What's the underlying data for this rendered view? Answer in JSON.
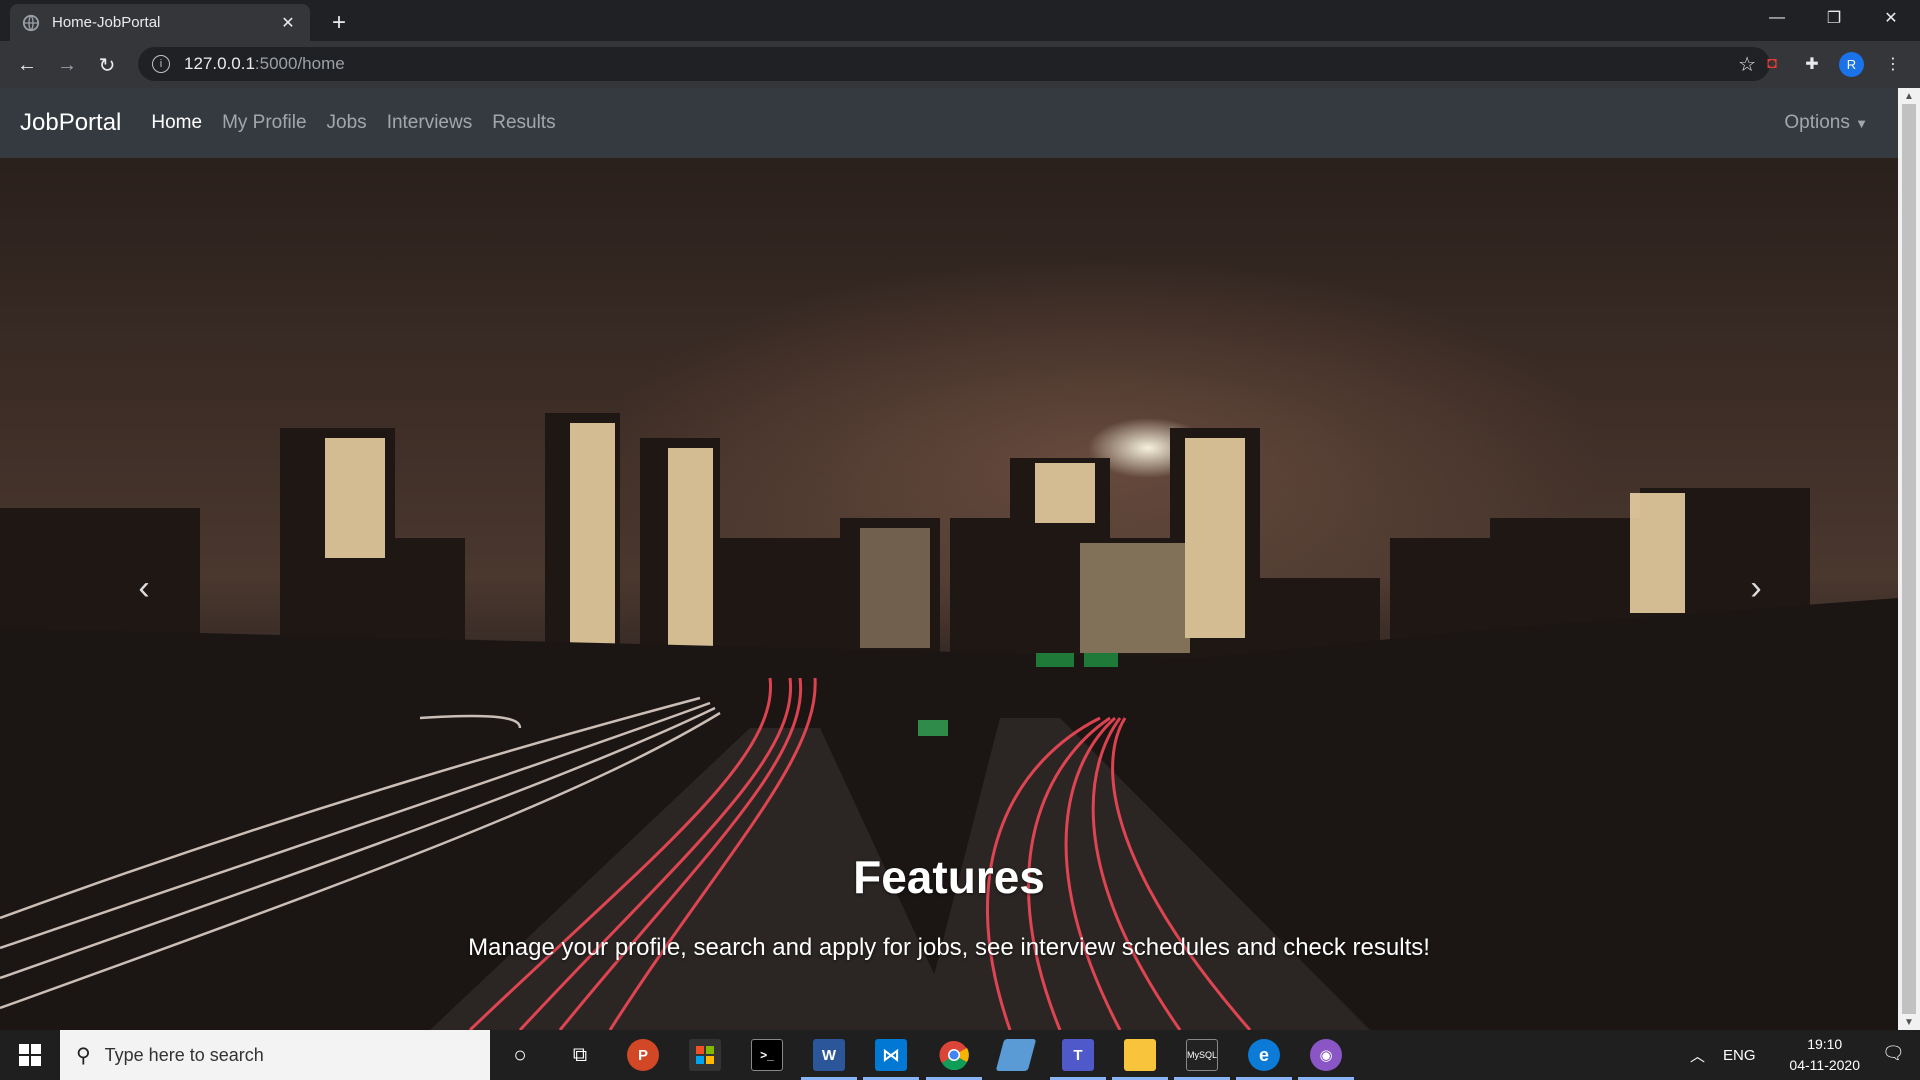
{
  "browser": {
    "tab_title": "Home-JobPortal",
    "url_host": "127.0.0.1",
    "url_path": ":5000/home",
    "profile_initial": "R"
  },
  "navbar": {
    "brand": "JobPortal",
    "links": [
      "Home",
      "My Profile",
      "Jobs",
      "Interviews",
      "Results"
    ],
    "active_index": 0,
    "options_label": "Options"
  },
  "carousel": {
    "title": "Features",
    "text": "Manage your profile, search and apply for jobs, see interview schedules and check results!",
    "slide_count": 3,
    "active_slide": 1
  },
  "taskbar": {
    "search_placeholder": "Type here to search",
    "language": "ENG",
    "time": "19:10",
    "date": "04-11-2020",
    "apps": [
      "cortana-icon",
      "task-view-icon",
      "powerpoint-icon",
      "store-icon",
      "terminal-icon",
      "word-icon",
      "vscode-icon",
      "chrome-icon",
      "notepad-icon",
      "teams-icon",
      "file-explorer-icon",
      "mysql-icon",
      "edge-icon",
      "github-desktop-icon"
    ]
  },
  "colors": {
    "navbar_bg": "#343a40",
    "chrome_dark": "#202124",
    "chrome_toolbar": "#35363a",
    "taskbar_bg": "#1f1f1f"
  }
}
